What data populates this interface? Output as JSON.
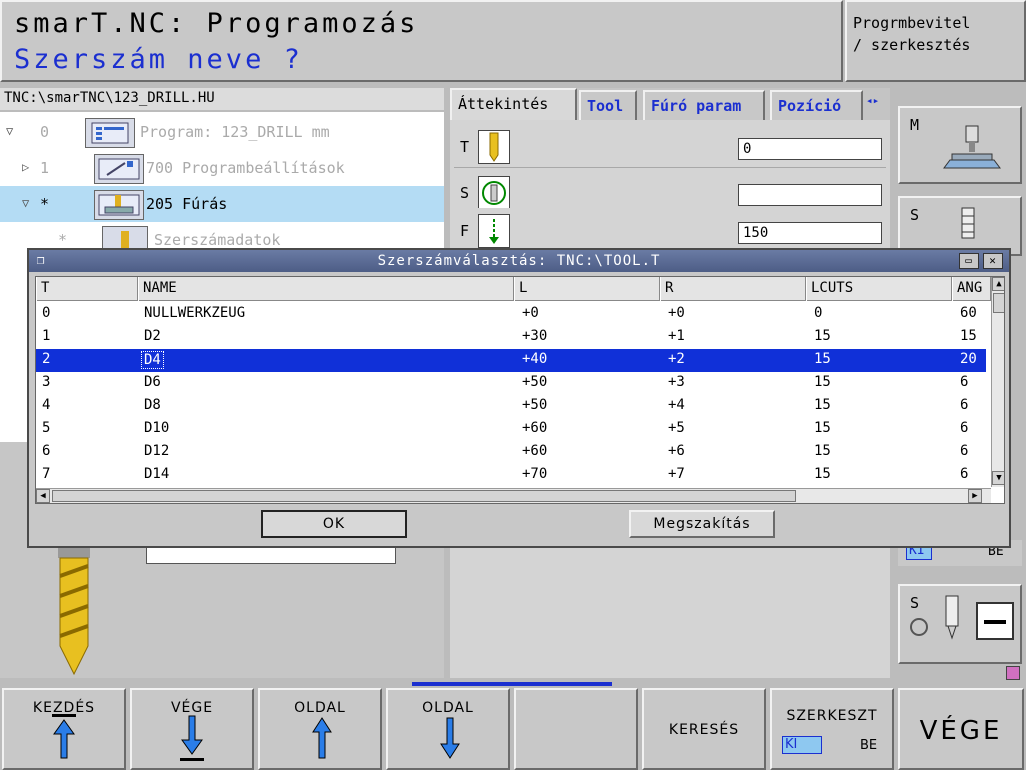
{
  "header": {
    "title": "smarT.NC: Programozás",
    "prompt": "Szerszám neve ?",
    "mode": [
      "Progrmbevitel",
      "/ szerkesztés"
    ]
  },
  "tree": {
    "path": "TNC:\\smarTNC\\123_DRILL.HU",
    "rows": [
      {
        "arrow": "▽",
        "num": "0",
        "label": "Program: 123_DRILL mm"
      },
      {
        "arrow": "▷",
        "num": "1",
        "label": "700 Programbeállítások"
      },
      {
        "arrow": "▽",
        "num": "*",
        "label": "205 Fúrás"
      },
      {
        "arrow": "",
        "num": "*",
        "label": "Szerszámadatok"
      }
    ]
  },
  "tabs": [
    {
      "label": "Áttekintés"
    },
    {
      "label": "Tool"
    },
    {
      "label": "Fúró param"
    },
    {
      "label": "Pozíció"
    }
  ],
  "form": {
    "rows": [
      {
        "letter": "T",
        "icon": "drill-bit-icon",
        "value": "0"
      },
      {
        "letter": "S",
        "icon": "spindle-rotation-icon",
        "value": ""
      },
      {
        "letter": "F",
        "icon": "feed-arrow-icon",
        "value": "150"
      }
    ]
  },
  "side": {
    "m_key": "M",
    "s_key": "S",
    "s_key2": "S",
    "ki": "KI",
    "be": "BE"
  },
  "dialog": {
    "title": "Szerszámválasztás: TNC:\\TOOL.T",
    "columns": [
      "T",
      "NAME",
      "L",
      "R",
      "LCUTS",
      "ANG"
    ],
    "rows": [
      [
        "0",
        "NULLWERKZEUG",
        "+0",
        "+0",
        "0",
        "60"
      ],
      [
        "1",
        "D2",
        "+30",
        "+1",
        "15",
        "15"
      ],
      [
        "2",
        "D4",
        "+40",
        "+2",
        "15",
        "20"
      ],
      [
        "3",
        "D6",
        "+50",
        "+3",
        "15",
        "6"
      ],
      [
        "4",
        "D8",
        "+50",
        "+4",
        "15",
        "6"
      ],
      [
        "5",
        "D10",
        "+60",
        "+5",
        "15",
        "6"
      ],
      [
        "6",
        "D12",
        "+60",
        "+6",
        "15",
        "6"
      ],
      [
        "7",
        "D14",
        "+70",
        "+7",
        "15",
        "6"
      ]
    ],
    "selected_index": 2,
    "ok": "OK",
    "cancel": "Megszakítás"
  },
  "softkeys": {
    "start": "KEZDÉS",
    "end": "VÉGE",
    "page_up": "OLDAL",
    "page_down": "OLDAL",
    "search": "KERESÉS",
    "edit": "SZERKESZT",
    "edit_off": "KI",
    "edit_on": "BE",
    "exit": "VÉGE"
  },
  "colors": {
    "accent_blue": "#1b2fd0",
    "selection": "#1030d8",
    "tree_highlight": "#b4dcf4"
  }
}
